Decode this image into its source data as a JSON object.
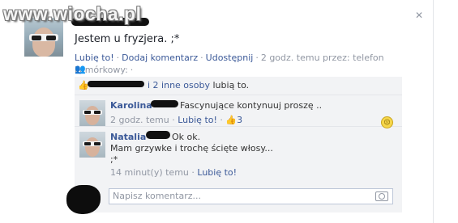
{
  "watermark": "www.wiocha.pl",
  "post": {
    "text": "Jestem u fryzjera. ;*",
    "actions": {
      "like": "Lubię to!",
      "comment": "Dodaj komentarz",
      "share": "Udostępnij",
      "time": "2 godz. temu przez: telefon komórkowy:"
    }
  },
  "likes": {
    "link": "i 2 inne osoby",
    "suffix": "lubią to."
  },
  "comments": [
    {
      "author": "Karolina",
      "text": "Fascynujące kontynuuj proszę ..",
      "time": "2 godz. temu",
      "like": "Lubię to!",
      "like_count": "3"
    },
    {
      "author": "Natalia",
      "text_line1": "Ok ok.",
      "text_line2": "Mam grzywke i trochę ścięte włosy...",
      "text_line3": ";*",
      "time": "14 minut(y) temu",
      "like": "Lubię to!"
    }
  ],
  "composer": {
    "placeholder": "Napisz komentarz..."
  },
  "icons": [
    "close-icon",
    "friends-icon",
    "thumbs-up-icon",
    "smiley-icon",
    "camera-icon"
  ]
}
